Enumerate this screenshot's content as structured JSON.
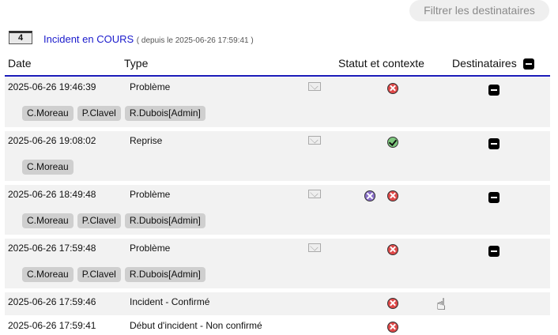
{
  "filter_button": "Filtrer les destinataires",
  "incident": {
    "count": "4",
    "title": "Incident en COURS",
    "since": "( depuis le 2025-06-26 17:59:41 )"
  },
  "headers": {
    "date": "Date",
    "type": "Type",
    "status": "Statut et contexte",
    "recipients": "Destinataires"
  },
  "rows": [
    {
      "date": "2025-06-26 19:46:39",
      "type": "Problème",
      "mail": true,
      "status": [
        "error"
      ],
      "recipients_toggle": true,
      "tags": [
        "C.Moreau",
        "P.Clavel",
        "R.Dubois[Admin]"
      ]
    },
    {
      "date": "2025-06-26 19:08:02",
      "type": "Reprise",
      "mail": true,
      "status": [
        "ok"
      ],
      "recipients_toggle": true,
      "tags": [
        "C.Moreau"
      ]
    },
    {
      "date": "2025-06-26 18:49:48",
      "type": "Problème",
      "mail": true,
      "status": [
        "maintenance",
        "error"
      ],
      "recipients_toggle": true,
      "tags": [
        "C.Moreau",
        "P.Clavel",
        "R.Dubois[Admin]"
      ]
    },
    {
      "date": "2025-06-26 17:59:48",
      "type": "Problème",
      "mail": true,
      "status": [
        "error"
      ],
      "recipients_toggle": true,
      "tags": [
        "C.Moreau",
        "P.Clavel",
        "R.Dubois[Admin]"
      ]
    },
    {
      "date": "2025-06-26 17:59:46",
      "type": "Incident - Confirmé",
      "mail": false,
      "status": [
        "error"
      ],
      "recipients_toggle": false,
      "tags": []
    },
    {
      "date": "2025-06-26 17:59:41",
      "type": "Début d'incident - Non confirmé",
      "mail": false,
      "status": [
        "error"
      ],
      "recipients_toggle": false,
      "tags": []
    }
  ],
  "icons": {
    "error": "error-circle-icon",
    "ok": "check-circle-icon",
    "maintenance": "tools-icon",
    "mail": "envelope-icon",
    "collapse": "minus-square-icon"
  }
}
